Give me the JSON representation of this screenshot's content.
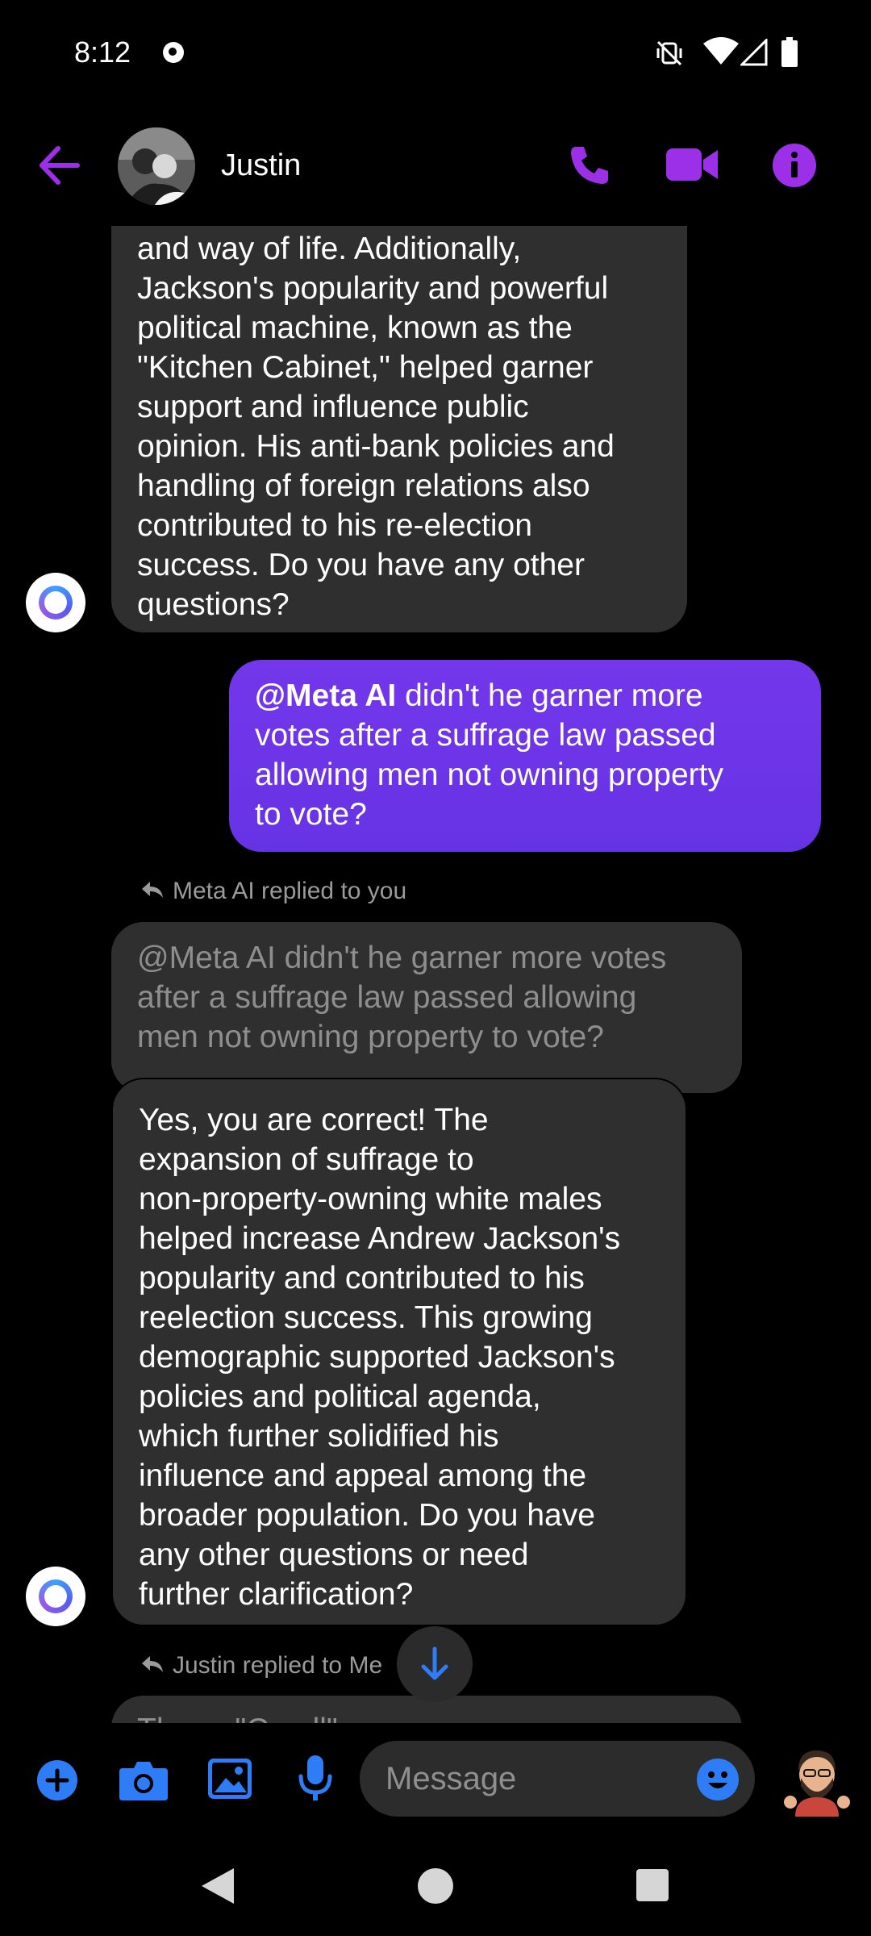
{
  "status_bar": {
    "time": "8:12",
    "icons": [
      "notification-dot-icon",
      "vibrate-off-icon",
      "wifi-icon",
      "cell-signal-icon",
      "battery-icon"
    ]
  },
  "header": {
    "back_icon": "arrow-left-icon",
    "contact_name": "Justin",
    "actions": [
      "phone-icon",
      "video-icon",
      "info-icon"
    ],
    "accent_color": "#9b30e8"
  },
  "messages": {
    "ai_message_1": {
      "lines": [
        "and way of life. Additionally,",
        "Jackson's popularity and powerful",
        "political machine, known as the",
        "\"Kitchen Cabinet,\" helped garner",
        "support and influence public",
        "opinion. His anti-bank policies and",
        "handling of foreign relations also",
        "contributed to his re-election",
        "success. Do you have any other",
        "questions?"
      ]
    },
    "user_message": {
      "mention": "@Meta AI",
      "text_line1": " didn't he garner more",
      "lines": [
        "votes after a suffrage law passed",
        "allowing men not owning property",
        "to vote?"
      ]
    },
    "reply_label_1": "Meta AI replied to you",
    "quoted_message": {
      "lines": [
        "@Meta AI didn't he garner more votes",
        "after a suffrage law passed allowing",
        "men not owning property to vote?"
      ]
    },
    "ai_message_2": {
      "lines": [
        "Yes, you are correct! The",
        "expansion of suffrage to",
        "non-property-owning white males",
        "helped increase Andrew Jackson's",
        "popularity and contributed to his",
        "reelection success. This growing",
        "demographic supported Jackson's",
        "policies and political agenda,",
        "which further solidified his",
        "influence and appeal among the",
        "broader population. Do you have",
        "any other questions or need",
        "further clarification?"
      ]
    },
    "reply_label_2": "Justin replied to Me",
    "partial_next": "The ... \"C ... ll\""
  },
  "composer": {
    "placeholder": "Message",
    "icons": [
      "plus-circle-icon",
      "camera-icon",
      "image-icon",
      "microphone-icon",
      "emoji-icon",
      "sticker-avatar-icon"
    ],
    "icon_color": "#2f7df6"
  },
  "nav_bar": {
    "icons": [
      "back-triangle-icon",
      "home-circle-icon",
      "recents-square-icon"
    ]
  }
}
